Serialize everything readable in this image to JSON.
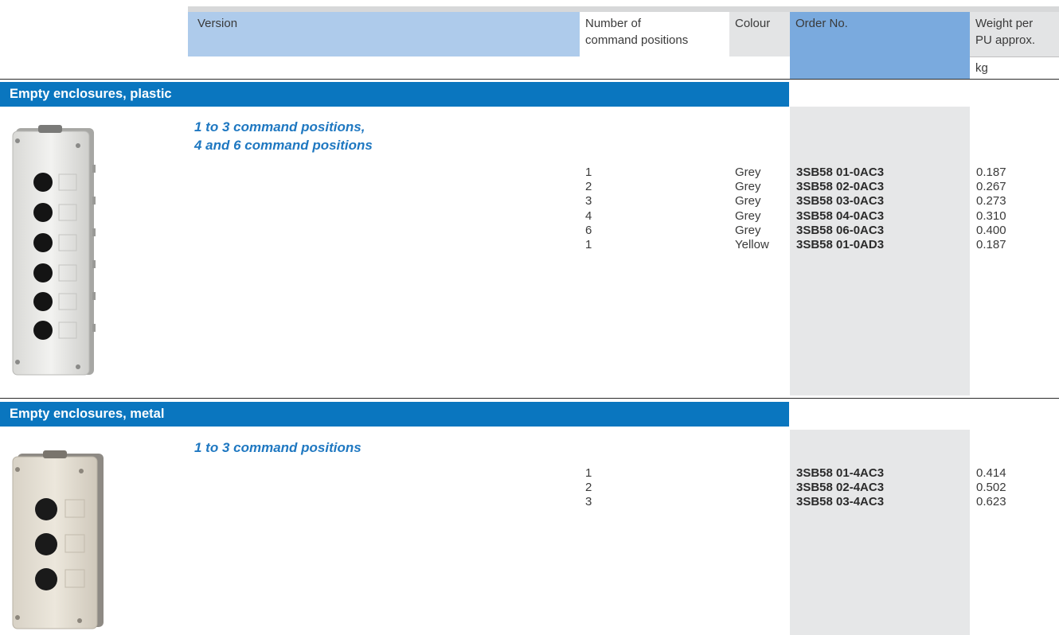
{
  "header": {
    "version": "Version",
    "num_positions_line1": "Number of",
    "num_positions_line2": "command positions",
    "colour": "Colour",
    "order_no": "Order No.",
    "weight_line1": "Weight per",
    "weight_line2": "PU approx.",
    "weight_unit": "kg"
  },
  "sections": [
    {
      "title": "Empty enclosures, plastic",
      "subtitle_line1": "1 to 3 command positions,",
      "subtitle_line2": "4 and 6 command positions",
      "image_icon": "grey-plastic-pushbutton-enclosure-6-holes",
      "rows": [
        {
          "num": "1",
          "colour": "Grey",
          "order": "3SB58 01-0AC3",
          "weight": "0.187"
        },
        {
          "num": "2",
          "colour": "Grey",
          "order": "3SB58 02-0AC3",
          "weight": "0.267"
        },
        {
          "num": "3",
          "colour": "Grey",
          "order": "3SB58 03-0AC3",
          "weight": "0.273"
        },
        {
          "num": "4",
          "colour": "Grey",
          "order": "3SB58 04-0AC3",
          "weight": "0.310"
        },
        {
          "num": "6",
          "colour": "Grey",
          "order": "3SB58 06-0AC3",
          "weight": "0.400"
        },
        {
          "num": "1",
          "colour": "Yellow",
          "order": "3SB58 01-0AD3",
          "weight": "0.187"
        }
      ]
    },
    {
      "title": "Empty enclosures, metal",
      "subtitle_line1": "1 to 3 command positions",
      "image_icon": "metal-pushbutton-enclosure-3-holes",
      "rows": [
        {
          "num": "1",
          "colour": "",
          "order": "3SB58 01-4AC3",
          "weight": "0.414"
        },
        {
          "num": "2",
          "colour": "",
          "order": "3SB58 02-4AC3",
          "weight": "0.502"
        },
        {
          "num": "3",
          "colour": "",
          "order": "3SB58 03-4AC3",
          "weight": "0.623"
        }
      ]
    }
  ],
  "colors": {
    "section_bar": "#0a76bf",
    "subtitle": "#1f78c1",
    "order_header": "#7aaade",
    "version_header": "#aecbeb",
    "grey_band": "#e6e7e8"
  }
}
